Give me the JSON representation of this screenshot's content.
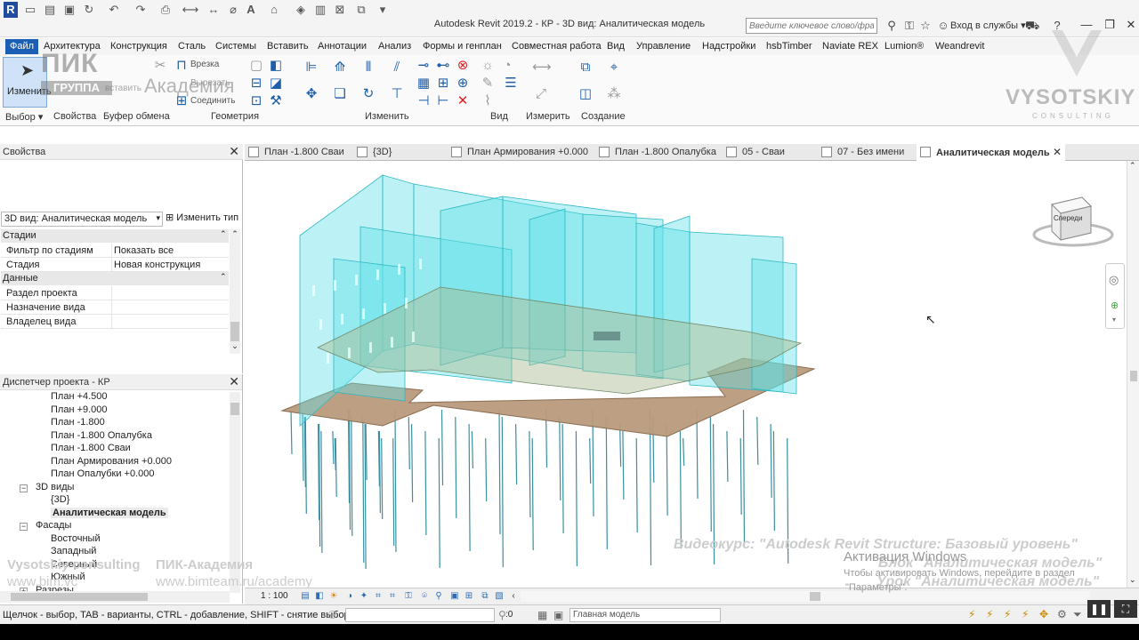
{
  "app": {
    "title": "Autodesk Revit 2019.2 - КР - 3D вид: Аналитическая модель",
    "logo_letter": "R",
    "search_placeholder": "Введите ключевое слово/фразу",
    "login": "Вход в службы"
  },
  "ribbon": {
    "tabs": [
      "Файл",
      "Архитектура",
      "Конструкция",
      "Сталь",
      "Системы",
      "Вставить",
      "Аннотации",
      "Анализ",
      "Формы и генплан",
      "Совместная работа",
      "Вид",
      "Управление",
      "Надстройки",
      "hsbTimber",
      "Naviate REX",
      "Lumion®",
      "Weandrevit"
    ],
    "active_tab": "Файл",
    "modify_label": "Изменить",
    "paste_label": "вставить",
    "geometry_items": [
      "Врезка",
      "Вырезать",
      "Соединить"
    ],
    "panels": [
      "Выбор",
      "Свойства",
      "Буфер обмена",
      "Геометрия",
      "Изменить",
      "Вид",
      "Измерить",
      "Создание"
    ]
  },
  "watermarks": {
    "pik": "ПИК",
    "group": "ГРУППА",
    "academy": "Академия",
    "vysotskiy": "VYSOTSKIY",
    "consulting": "CONSULTING"
  },
  "properties": {
    "header": "Свойства",
    "type_value": "3D вид: Аналитическая модель",
    "edit_type": "Изменить тип",
    "categories": [
      {
        "name": "Стадии",
        "rows": [
          {
            "key": "Фильтр по стадиям",
            "value": "Показать все"
          },
          {
            "key": "Стадия",
            "value": "Новая конструкция"
          }
        ]
      },
      {
        "name": "Данные",
        "rows": [
          {
            "key": "Раздел проекта",
            "value": ""
          },
          {
            "key": "Назначение вида",
            "value": ""
          },
          {
            "key": "Владелец вида",
            "value": ""
          }
        ]
      }
    ]
  },
  "browser": {
    "header": "Диспетчер проекта - КР",
    "items": [
      {
        "label": "План +4.500",
        "indent": 2
      },
      {
        "label": "План +9.000",
        "indent": 2
      },
      {
        "label": "План -1.800",
        "indent": 2
      },
      {
        "label": "План -1.800 Опалубка",
        "indent": 2
      },
      {
        "label": "План -1.800 Сваи",
        "indent": 2
      },
      {
        "label": "План Армирования +0.000",
        "indent": 2
      },
      {
        "label": "План Опалубки +0.000",
        "indent": 2
      },
      {
        "label": "3D виды",
        "indent": 1,
        "toggle": "−"
      },
      {
        "label": "{3D}",
        "indent": 2
      },
      {
        "label": "Аналитическая модель",
        "indent": 2,
        "bold": true
      },
      {
        "label": "Фасады",
        "indent": 1,
        "toggle": "−"
      },
      {
        "label": "Восточный",
        "indent": 2
      },
      {
        "label": "Западный",
        "indent": 2
      },
      {
        "label": "Северный",
        "indent": 2
      },
      {
        "label": "Южный",
        "indent": 2
      },
      {
        "label": "Разрезы",
        "indent": 1,
        "toggle": "+"
      }
    ]
  },
  "view_tabs": [
    "План -1.800 Сваи",
    "{3D}",
    "План Армирования +0.000",
    "План -1.800 Опалубка",
    "05 - Сваи",
    "07 - Без имени",
    "Аналитическая модель"
  ],
  "active_view_tab": "Аналитическая модель",
  "viewcube_label": "Спереди",
  "view_control": {
    "scale": "1 : 100"
  },
  "status": {
    "text": "Щелчок - выбор, TAB - варианты, CTRL - добавление, SHIFT - снятие выбора.",
    "selected": ":0",
    "model": "Главная модель"
  },
  "overlays": {
    "course": "Видеокурс: \"Autodesk Revit Structure: Базовый уровень\"",
    "block": "Блок \"Аналитическая модель\"",
    "lesson": "Урок \"Аналитическая модель\"",
    "activation_title": "Активация Windows",
    "activation_line1": "Чтобы активировать Windows, перейдите в раздел",
    "activation_line2": "\"Параметры\".",
    "vc": "Vysotskiy consulting",
    "pik": "ПИК-Академия",
    "url1": "www.bim.vc",
    "url2": "www.bimteam.ru/academy"
  },
  "colors": {
    "accent": "#1a5fb4",
    "walls": "#5fe0e6",
    "slab": "#b99a7c",
    "piles": "#3a8fa0"
  }
}
